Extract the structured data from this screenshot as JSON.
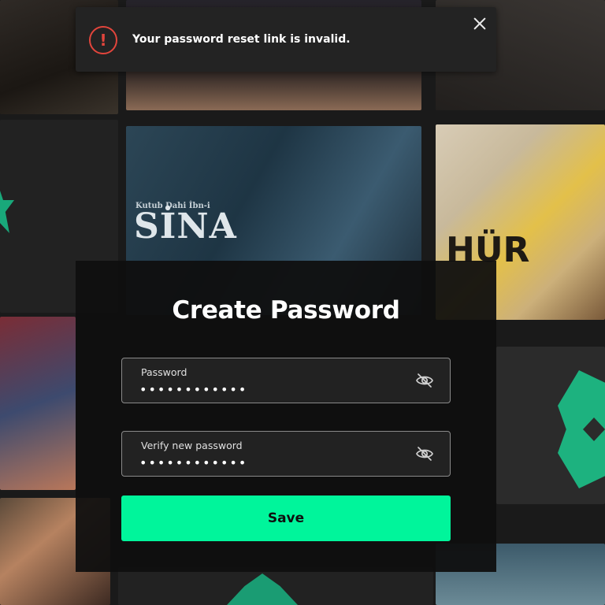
{
  "toast": {
    "message": "Your password reset link is invalid.",
    "icon": "alert-icon",
    "icon_glyph": "!",
    "close_icon": "close-icon",
    "accent_color": "#e2453c"
  },
  "background": {
    "poster_sina_small": "Kutub Dahi İbn-i",
    "poster_sina": "SİNA",
    "poster_hur": "HÜR",
    "brand_color": "#19a87a"
  },
  "modal": {
    "title": "Create Password",
    "fields": [
      {
        "label": "Password",
        "value": "••••••••••••",
        "icon": "eye-slash-icon"
      },
      {
        "label": "Verify new password",
        "value": "••••••••••••",
        "icon": "eye-slash-icon"
      }
    ],
    "save_label": "Save",
    "save_color": "#00f59b"
  }
}
